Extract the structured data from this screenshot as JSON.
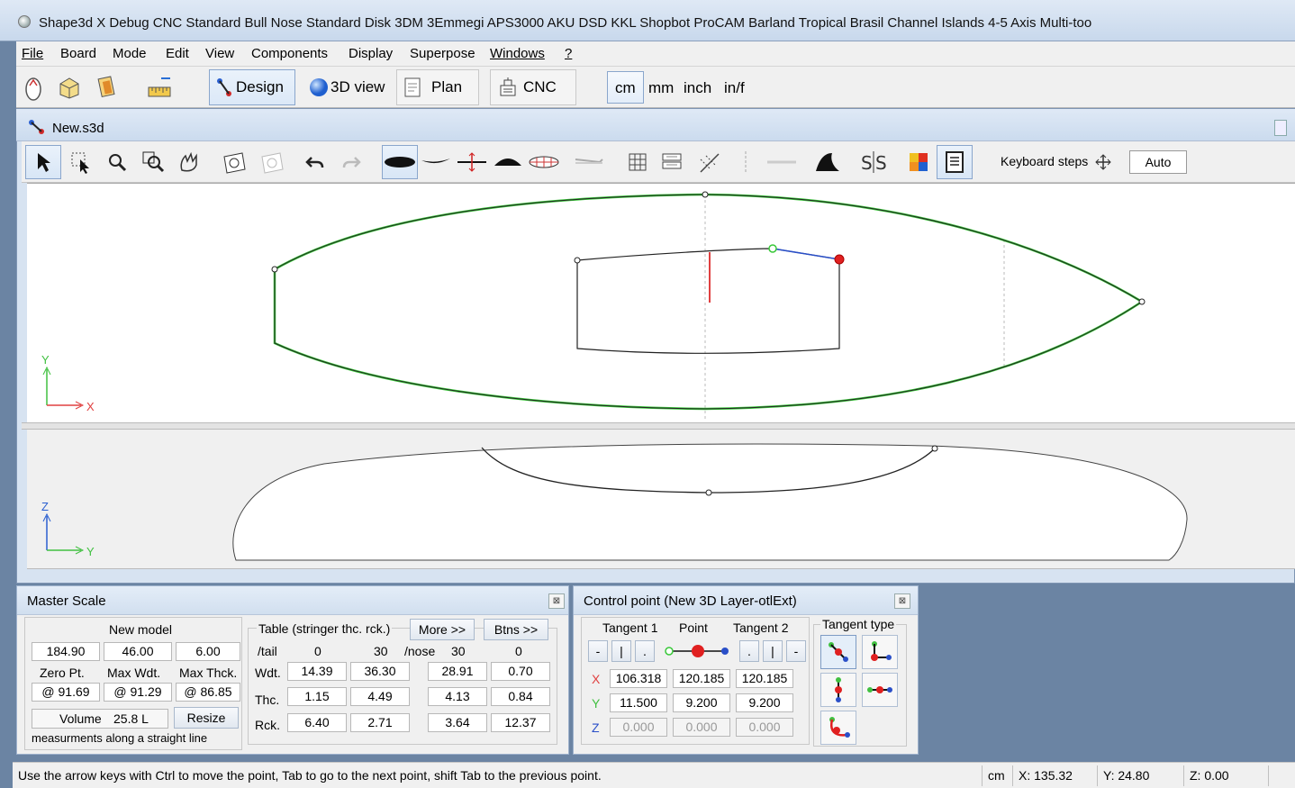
{
  "window": {
    "title": "Shape3d X Debug CNC  Standard Bull Nose Standard Disk 3DM 3Emmegi APS3000 AKU DSD KKL Shopbot ProCAM Barland Tropical Brasil Channel Islands 4-5 Axis Multi-too"
  },
  "menu": [
    "File",
    "Board",
    "Mode",
    "Edit",
    "View",
    "Components",
    "Display",
    "Superpose",
    "Windows",
    "?"
  ],
  "toolbar": {
    "tabs": [
      {
        "label": "Design",
        "icon": "design-icon",
        "pressed": true
      },
      {
        "label": "3D view",
        "icon": "globe-icon",
        "pressed": false
      },
      {
        "label": "Plan",
        "icon": "plan-icon",
        "pressed": false
      },
      {
        "label": "CNC",
        "icon": "cnc-icon",
        "pressed": false
      }
    ],
    "units": [
      "cm",
      "mm",
      "inch",
      "in/f"
    ],
    "selected_unit": "cm"
  },
  "document": {
    "title": "New.s3d",
    "keyboard_steps_label": "Keyboard steps",
    "keyboard_steps_value": "Auto",
    "top_view_axes": {
      "vertical": "Y",
      "horizontal": "X"
    },
    "bottom_view_axes": {
      "vertical": "Z",
      "horizontal": "Y"
    }
  },
  "master_scale": {
    "title": "Master Scale",
    "new_model_label": "New model",
    "length": "184.90",
    "max_width": "46.00",
    "max_thickness": "6.00",
    "zero_pt_label": "Zero Pt.",
    "max_wdt_label": "Max Wdt.",
    "max_thck_label": "Max Thck.",
    "zero_pt_value": "@ 91.69",
    "max_wdt_pos": "@ 91.29",
    "max_thck_pos": "@ 86.85",
    "volume_label": "Volume",
    "volume_value": "25.8 L",
    "resize_label": "Resize",
    "note": "measurments along a straight line",
    "table_title": "Table (stringer thc. rck.)",
    "more_label": "More >>",
    "btns_label": "Btns >>",
    "header": {
      "tail": "/tail",
      "c1": "0",
      "c2": "30",
      "nose": "/nose",
      "c3": "30",
      "c4": "0"
    },
    "rows": [
      {
        "label": "Wdt.",
        "values": [
          "14.39",
          "36.30",
          "28.91",
          "0.70"
        ]
      },
      {
        "label": "Thc.",
        "values": [
          "1.15",
          "4.49",
          "4.13",
          "0.84"
        ]
      },
      {
        "label": "Rck.",
        "values": [
          "6.40",
          "2.71",
          "3.64",
          "12.37"
        ]
      }
    ]
  },
  "control_point": {
    "title": "Control point (New 3D Layer-otlExt)",
    "col_tangent1": "Tangent 1",
    "col_point": "Point",
    "col_tangent2": "Tangent 2",
    "tangent_type_label": "Tangent type",
    "mini_buttons": [
      "-",
      "|",
      "."
    ],
    "mini_buttons2": [
      ".",
      "|",
      "-"
    ],
    "x_label": "X",
    "y_label": "Y",
    "z_label": "Z",
    "x": [
      "106.318",
      "120.185",
      "120.185"
    ],
    "y": [
      "11.500",
      "9.200",
      "9.200"
    ],
    "z": [
      "0.000",
      "0.000",
      "0.000"
    ]
  },
  "status": {
    "message": "Use the arrow keys with Ctrl to move the point, Tab to go to the next point, shift Tab to the previous point.",
    "unit": "cm",
    "x": "X: 135.32",
    "y": "Y: 24.80",
    "z": "Z: 0.00"
  },
  "colors": {
    "outline_green": "#38c838",
    "selected_point": "#e02020",
    "axis_red": "#e04040",
    "axis_green": "#40c040"
  }
}
